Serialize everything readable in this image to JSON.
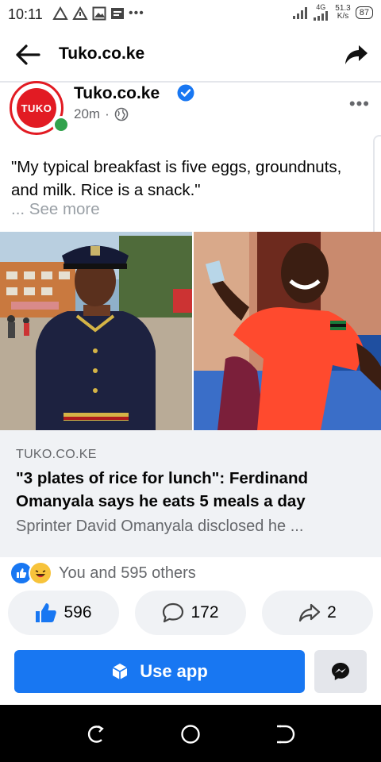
{
  "status_bar": {
    "time": "10:11",
    "net_speed_value": "51.3",
    "net_speed_unit": "K/s",
    "signal_label": "4G",
    "battery": "87",
    "more_dots": "•••"
  },
  "app_bar": {
    "title": "Tuko.co.ke"
  },
  "post": {
    "avatar_text": "TUKO",
    "page_name": "Tuko.co.ke",
    "time_ago": "20m",
    "meta_separator": "·",
    "text": "\"My typical breakfast is five eggs, groundnuts, and milk. Rice is a snack.\"",
    "see_more": "... See more",
    "more_dots": "•••"
  },
  "link_preview": {
    "domain": "TUKO.CO.KE",
    "title": "\"3 plates of rice for lunch\": Ferdinand Omanyala says he eats 5 meals a day",
    "description": "Sprinter David Omanyala disclosed he ..."
  },
  "reactions": {
    "summary": "You and 595 others"
  },
  "actions": {
    "like_count": "596",
    "comment_count": "172",
    "share_count": "2"
  },
  "banner": {
    "use_app_label": "Use app"
  },
  "colors": {
    "brand_blue": "#1877f2",
    "tuko_red": "#e21b23",
    "online_green": "#31a24c"
  }
}
